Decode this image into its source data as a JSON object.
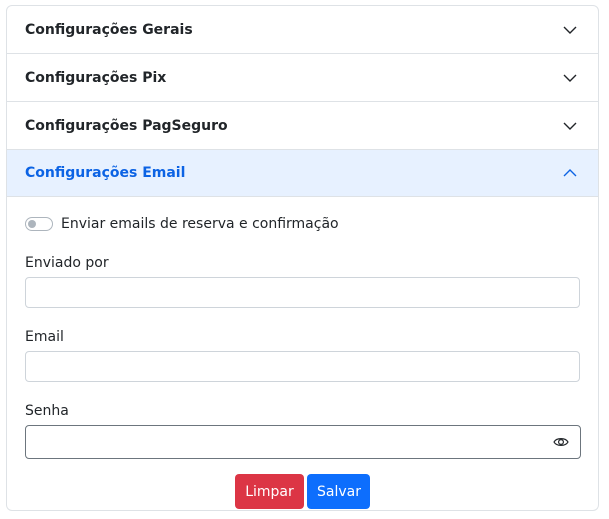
{
  "sections": [
    {
      "label": "Configurações Gerais"
    },
    {
      "label": "Configurações Pix"
    },
    {
      "label": "Configurações PagSeguro"
    },
    {
      "label": "Configurações Email"
    }
  ],
  "email": {
    "toggle_label": "Enviar emails de reserva e confirmação",
    "toggle_on": false,
    "sender_label": "Enviado por",
    "sender_value": "",
    "email_label": "Email",
    "email_value": "",
    "password_label": "Senha",
    "password_value": ""
  },
  "actions": {
    "clear_label": "Limpar",
    "save_label": "Salvar"
  },
  "colors": {
    "active_header_bg": "#e7f1ff",
    "active_header_text": "#0c63e4",
    "danger": "#dc3545",
    "primary": "#0d6efd"
  },
  "icons": {
    "collapsed": "chevron-down-icon",
    "expanded": "chevron-up-icon",
    "password_toggle": "eye-icon"
  }
}
